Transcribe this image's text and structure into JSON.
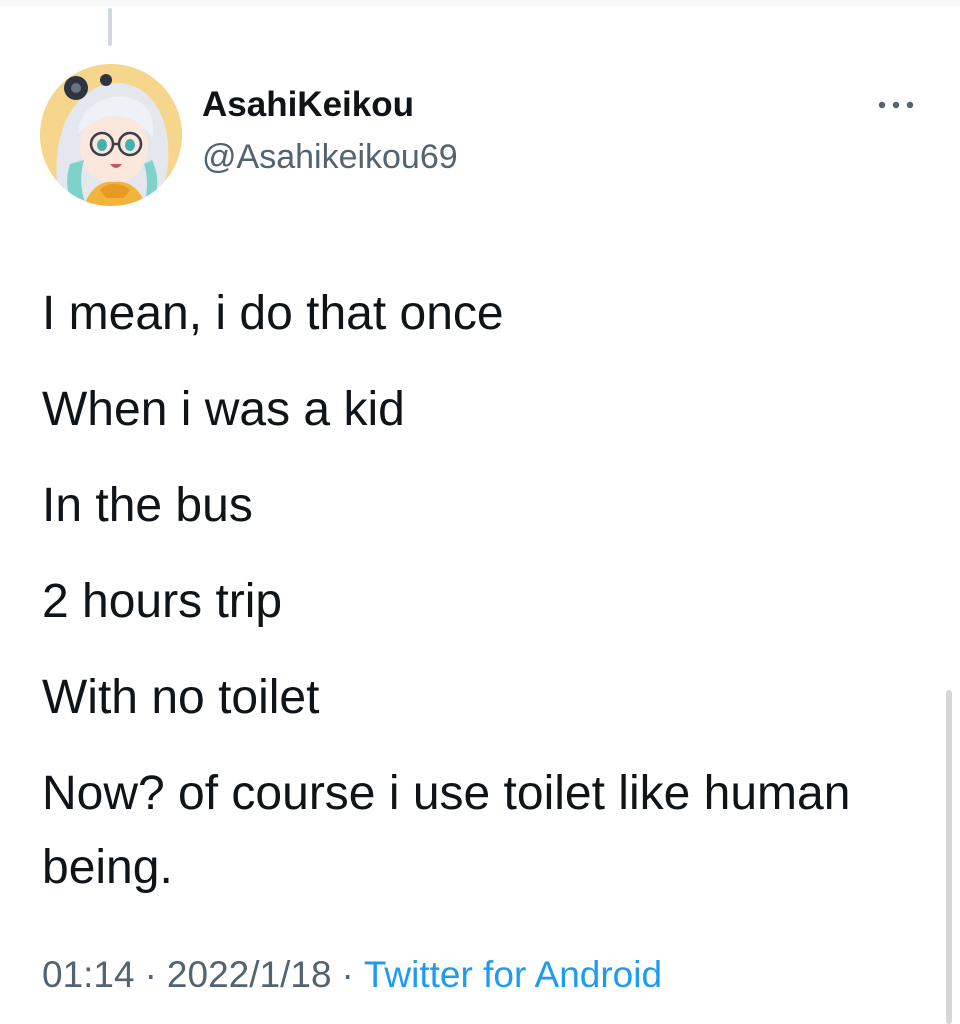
{
  "tweet": {
    "author": {
      "display_name": "AsahiKeikou",
      "handle": "@Asahikeikou69"
    },
    "text_lines": [
      "I mean, i do that once",
      "When i was a kid",
      "In the bus",
      "2 hours trip",
      "With no toilet",
      "Now? of course i use toilet like human being."
    ],
    "time": "01:14",
    "date": "2022/1/18",
    "separator": "·",
    "source": "Twitter for Android"
  },
  "icons": {
    "more": "more-horizontal-icon",
    "avatar": "anime-girl-avatar"
  },
  "colors": {
    "text_primary": "#0f1419",
    "text_secondary": "#536471",
    "link": "#1d9bf0",
    "thread_line": "#cfd9de"
  }
}
